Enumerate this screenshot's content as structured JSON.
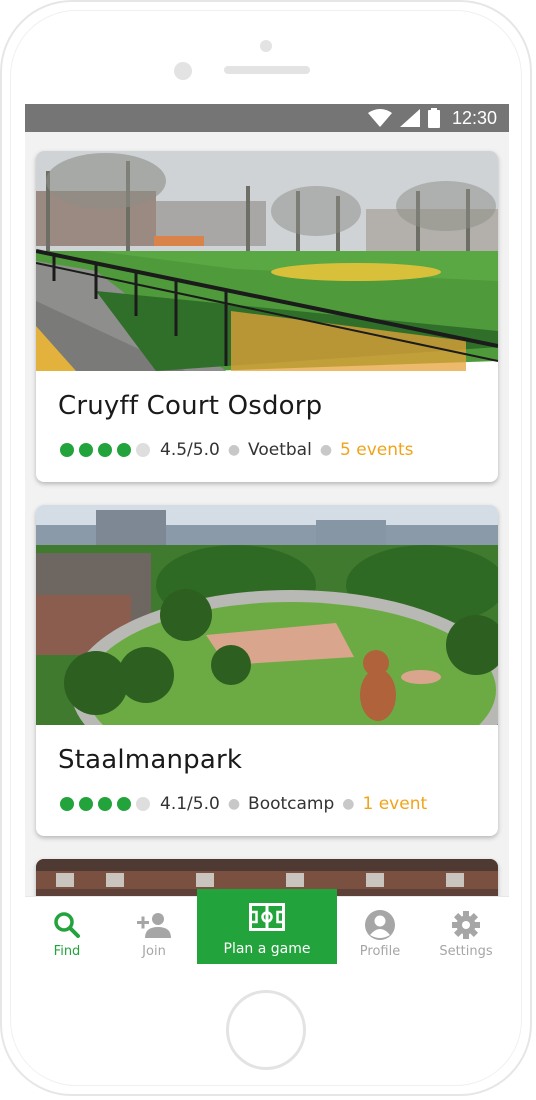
{
  "status_bar": {
    "time": "12:30",
    "icons": [
      "wifi-icon",
      "signal-icon",
      "battery-icon"
    ]
  },
  "venues": [
    {
      "name": "Cruyff Court Osdorp",
      "rating": "4.5/5.0",
      "rating_value": 4.5,
      "sport": "Voetbal",
      "events": "5 events",
      "image": "soccer-field-photo"
    },
    {
      "name": "Staalmanpark",
      "rating": "4.1/5.0",
      "rating_value": 4.1,
      "sport": "Bootcamp",
      "events": "1 event",
      "image": "park-aerial-photo"
    }
  ],
  "tabs": [
    {
      "label": "Find",
      "icon": "search-icon",
      "active": true
    },
    {
      "label": "Join",
      "icon": "add-user-icon",
      "active": false
    },
    {
      "label": "Plan a game",
      "icon": "field-icon",
      "highlight": true
    },
    {
      "label": "Profile",
      "icon": "profile-icon",
      "active": false
    },
    {
      "label": "Settings",
      "icon": "gear-icon",
      "active": false
    }
  ],
  "colors": {
    "accent": "#22a33c",
    "events": "#f0a41a",
    "status_bar": "#757575",
    "inactive": "#a6a6a6"
  }
}
